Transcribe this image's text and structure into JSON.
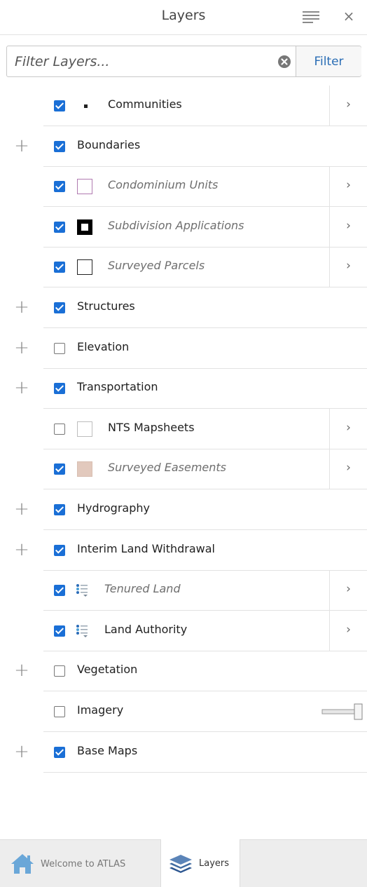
{
  "header": {
    "title": "Layers",
    "menu_icon": "list-icon",
    "close_label": "×"
  },
  "filter": {
    "placeholder": "Filter Layers...",
    "value": "",
    "button_label": "Filter",
    "clear_icon": "clear-circle-icon"
  },
  "layers": [
    {
      "label": "Communities",
      "checked": true,
      "level": 1,
      "expandable": false,
      "has_chevron": true,
      "symbol": "dot",
      "italic": false
    },
    {
      "label": "Boundaries",
      "checked": true,
      "level": 0,
      "expandable": true,
      "has_chevron": false,
      "italic": false
    },
    {
      "label": "Condominium Units",
      "checked": true,
      "level": 1,
      "expandable": false,
      "has_chevron": true,
      "symbol": "square-outline",
      "symbol_color": "#b07ab0",
      "italic": true
    },
    {
      "label": "Subdivision Applications",
      "checked": true,
      "level": 1,
      "expandable": false,
      "has_chevron": true,
      "symbol": "square-thick",
      "symbol_color": "#000000",
      "italic": true
    },
    {
      "label": "Surveyed Parcels",
      "checked": true,
      "level": 1,
      "expandable": false,
      "has_chevron": true,
      "symbol": "square-outline",
      "symbol_color": "#222222",
      "italic": true
    },
    {
      "label": "Structures",
      "checked": true,
      "level": 0,
      "expandable": true,
      "has_chevron": false,
      "italic": false
    },
    {
      "label": "Elevation",
      "checked": false,
      "level": 0,
      "expandable": true,
      "has_chevron": false,
      "italic": false
    },
    {
      "label": "Transportation",
      "checked": true,
      "level": 0,
      "expandable": true,
      "has_chevron": false,
      "italic": false
    },
    {
      "label": "NTS Mapsheets",
      "checked": false,
      "level": 1,
      "expandable": false,
      "has_chevron": true,
      "symbol": "square-outline",
      "symbol_color": "#bdbdbd",
      "italic": false
    },
    {
      "label": "Surveyed Easements",
      "checked": true,
      "level": 1,
      "expandable": false,
      "has_chevron": true,
      "symbol": "square-fill",
      "symbol_color": "#e2c9bd",
      "italic": true
    },
    {
      "label": "Hydrography",
      "checked": true,
      "level": 0,
      "expandable": true,
      "has_chevron": false,
      "italic": false
    },
    {
      "label": "Interim Land Withdrawal",
      "checked": true,
      "level": 0,
      "expandable": true,
      "has_chevron": false,
      "italic": false
    },
    {
      "label": "Tenured Land",
      "checked": true,
      "level": 1,
      "expandable": false,
      "has_chevron": true,
      "symbol": "legend-list",
      "italic": true
    },
    {
      "label": "Land Authority",
      "checked": true,
      "level": 1,
      "expandable": false,
      "has_chevron": true,
      "symbol": "legend-list",
      "italic": false
    },
    {
      "label": "Vegetation",
      "checked": false,
      "level": 0,
      "expandable": true,
      "has_chevron": false,
      "italic": false
    },
    {
      "label": "Imagery",
      "checked": false,
      "level": 0,
      "expandable": false,
      "has_chevron": false,
      "has_slider": true,
      "italic": false
    },
    {
      "label": "Base Maps",
      "checked": true,
      "level": 0,
      "expandable": true,
      "has_chevron": false,
      "italic": false
    }
  ],
  "tabs": [
    {
      "label": "Welcome to ATLAS",
      "icon": "home-icon",
      "active": false
    },
    {
      "label": "Layers",
      "icon": "layers-icon",
      "active": true
    }
  ],
  "colors": {
    "accent": "#1a6fd6",
    "filter_button_text": "#2a6db5",
    "home_icon": "#6aa7d8"
  }
}
